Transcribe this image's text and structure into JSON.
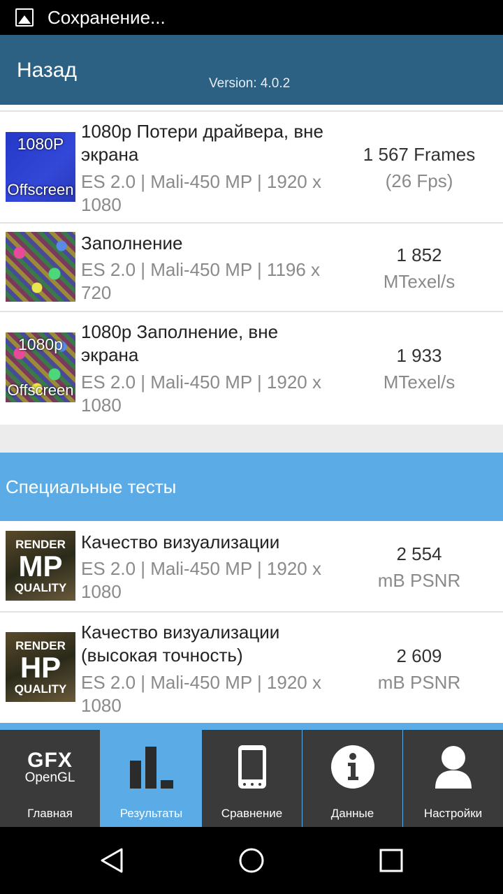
{
  "status_bar": {
    "text": "Сохранение..."
  },
  "header": {
    "back_label": "Назад",
    "version": "Version: 4.0.2"
  },
  "tests_top": [
    {
      "thumb_line1": "1080P",
      "thumb_line2": "Offscreen",
      "title": "1080p Потери драйвера, вне экрана",
      "subtitle": "ES 2.0 | Mali-450 MP | 1920 x 1080",
      "value": "1 567 Frames",
      "unit": "(26 Fps)"
    },
    {
      "title": "Заполнение",
      "subtitle": "ES 2.0 | Mali-450 MP | 1196 x 720",
      "value": "1 852",
      "unit": "MTexel/s"
    },
    {
      "thumb_line1": "1080p",
      "thumb_line2": "Offscreen",
      "title": "1080p Заполнение, вне экрана",
      "subtitle": "ES 2.0 | Mali-450 MP | 1920 x 1080",
      "value": "1 933",
      "unit": "MTexel/s"
    }
  ],
  "special_section": {
    "title": "Специальные тесты"
  },
  "tests_special": [
    {
      "thumb_line1": "RENDER",
      "thumb_line2": "MP",
      "thumb_line3": "QUALITY",
      "title": "Качество визуализации",
      "subtitle": "ES 2.0 | Mali-450 MP | 1920 x 1080",
      "value": "2 554",
      "unit": "mB PSNR"
    },
    {
      "thumb_line1": "RENDER",
      "thumb_line2": "HP",
      "thumb_line3": "QUALITY",
      "title": "Качество визуализации (высокая точность)",
      "subtitle": "ES 2.0 | Mali-450 MP | 1920 x 1080",
      "value": "2 609",
      "unit": "mB PSNR"
    }
  ],
  "tabs": {
    "home": {
      "label": "Главная",
      "logo_line1": "GFX",
      "logo_line2": "OpenGL"
    },
    "results": {
      "label": "Результаты",
      "active": true
    },
    "compare": {
      "label": "Сравнение"
    },
    "info": {
      "label": "Данные"
    },
    "settings": {
      "label": "Настройки"
    }
  },
  "colors": {
    "header": "#2c6184",
    "accent": "#5aabe6",
    "tab_inactive": "#3a3a3a"
  }
}
